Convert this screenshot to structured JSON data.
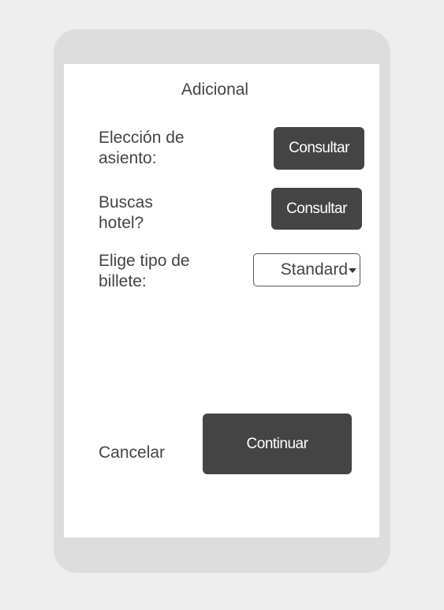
{
  "header": {
    "title": "Adicional"
  },
  "options": [
    {
      "label": "Elección de asiento:",
      "button": "Consultar"
    },
    {
      "label": "Buscas hotel?",
      "button": "Consultar"
    }
  ],
  "ticket": {
    "label": "Elige tipo de billete:",
    "selected": "Standard"
  },
  "footer": {
    "cancel": "Cancelar",
    "continue": "Continuar"
  }
}
